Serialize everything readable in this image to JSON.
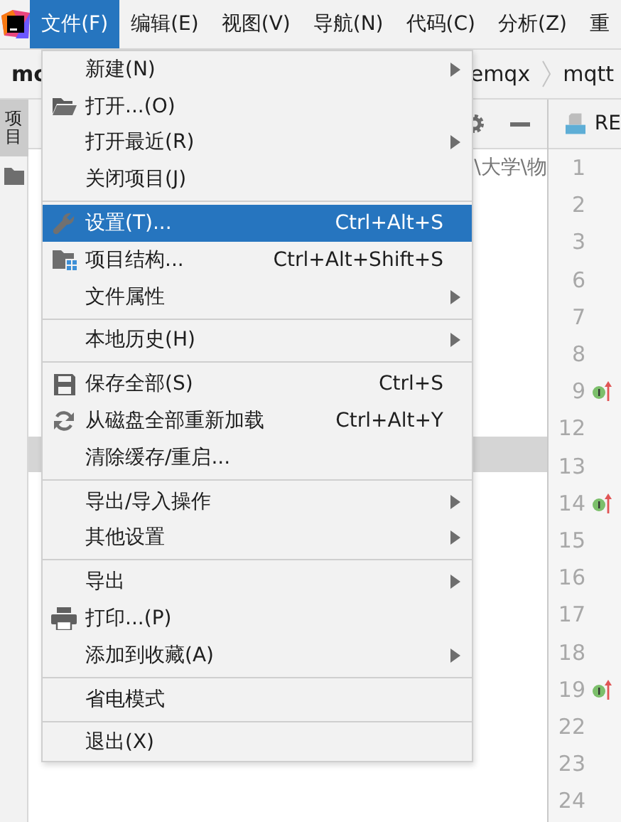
{
  "menubar": [
    {
      "label": "文件(F)",
      "selected": true
    },
    {
      "label": "编辑(E)",
      "selected": false
    },
    {
      "label": "视图(V)",
      "selected": false
    },
    {
      "label": "导航(N)",
      "selected": false
    },
    {
      "label": "代码(C)",
      "selected": false
    },
    {
      "label": "分析(Z)",
      "selected": false
    },
    {
      "label": "重",
      "selected": false
    }
  ],
  "navbar": {
    "project": "mc",
    "breadcrumbs": [
      "emqx",
      "mqtt"
    ]
  },
  "tool_strip": {
    "tab": "项目",
    "selected": true
  },
  "project_panel": {
    "path": "\\大学\\物"
  },
  "editor": {
    "tab": "RE",
    "lines": [
      {
        "number": "1",
        "marker": false
      },
      {
        "number": "2",
        "marker": false
      },
      {
        "number": "3",
        "marker": false
      },
      {
        "number": "6",
        "marker": false
      },
      {
        "number": "7",
        "marker": false
      },
      {
        "number": "8",
        "marker": false
      },
      {
        "number": "9",
        "marker": true
      },
      {
        "number": "12",
        "marker": false
      },
      {
        "number": "13",
        "marker": false
      },
      {
        "number": "14",
        "marker": true
      },
      {
        "number": "15",
        "marker": false
      },
      {
        "number": "16",
        "marker": false
      },
      {
        "number": "17",
        "marker": false
      },
      {
        "number": "18",
        "marker": false
      },
      {
        "number": "19",
        "marker": true
      },
      {
        "number": "22",
        "marker": false
      },
      {
        "number": "23",
        "marker": false
      },
      {
        "number": "24",
        "marker": false
      }
    ]
  },
  "menu": {
    "items": [
      {
        "kind": "item",
        "label": "新建(N)",
        "submenu": true,
        "selected": false
      },
      {
        "kind": "item",
        "label": "打开...(O)",
        "submenu": false,
        "selected": false
      },
      {
        "kind": "item",
        "label": "打开最近(R)",
        "submenu": true,
        "selected": false
      },
      {
        "kind": "item",
        "label": "关闭项目(J)",
        "submenu": false,
        "selected": false
      },
      {
        "kind": "separator"
      },
      {
        "kind": "item",
        "label": "设置(T)...",
        "shortcut": "Ctrl+Alt+S",
        "submenu": false,
        "selected": true
      },
      {
        "kind": "item",
        "label": "项目结构...",
        "shortcut": "Ctrl+Alt+Shift+S",
        "submenu": false,
        "selected": false
      },
      {
        "kind": "item",
        "label": "文件属性",
        "submenu": true,
        "selected": false
      },
      {
        "kind": "separator"
      },
      {
        "kind": "item",
        "label": "本地历史(H)",
        "submenu": true,
        "selected": false
      },
      {
        "kind": "separator"
      },
      {
        "kind": "item",
        "label": "保存全部(S)",
        "shortcut": "Ctrl+S",
        "submenu": false,
        "selected": false
      },
      {
        "kind": "item",
        "label": "从磁盘全部重新加载",
        "shortcut": "Ctrl+Alt+Y",
        "submenu": false,
        "selected": false
      },
      {
        "kind": "item",
        "label": "清除缓存/重启...",
        "submenu": false,
        "selected": false
      },
      {
        "kind": "separator"
      },
      {
        "kind": "item",
        "label": "导出/导入操作",
        "submenu": true,
        "selected": false
      },
      {
        "kind": "item",
        "label": "其他设置",
        "submenu": true,
        "selected": false
      },
      {
        "kind": "separator"
      },
      {
        "kind": "item",
        "label": "导出",
        "submenu": true,
        "selected": false
      },
      {
        "kind": "item",
        "label": "打印...(P)",
        "submenu": false,
        "selected": false
      },
      {
        "kind": "item",
        "label": "添加到收藏(A)",
        "submenu": true,
        "selected": false
      },
      {
        "kind": "separator"
      },
      {
        "kind": "item",
        "label": "省电模式",
        "submenu": false,
        "selected": false
      },
      {
        "kind": "separator"
      },
      {
        "kind": "item",
        "label": "退出(X)",
        "submenu": false,
        "selected": false
      }
    ]
  }
}
